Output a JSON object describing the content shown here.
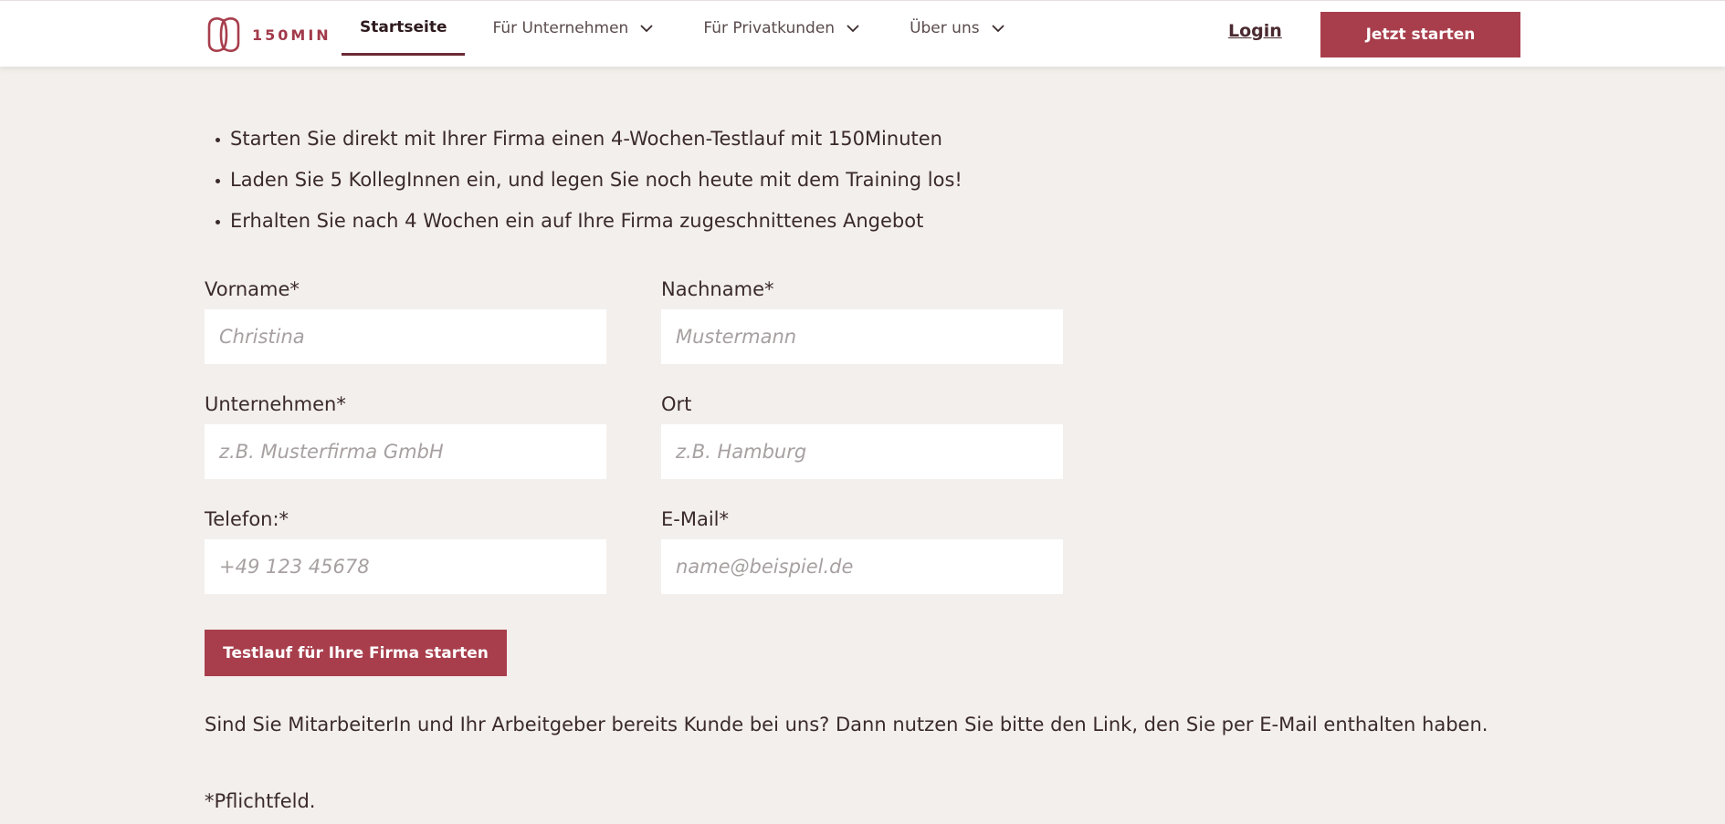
{
  "brand": {
    "logo_text": "150MIN",
    "accent": "#a83e4c",
    "icon": "logo-mark-icon"
  },
  "nav": {
    "items": [
      {
        "label": "Startseite"
      },
      {
        "label": "Für Unternehmen",
        "icon": "chevron-down-icon"
      },
      {
        "label": "Für Privatkunden",
        "icon": "chevron-down-icon"
      },
      {
        "label": "Über uns",
        "icon": "chevron-down-icon"
      }
    ],
    "login": "Login",
    "cta": "Jetzt starten"
  },
  "intro": {
    "bullets": [
      "Starten Sie direkt mit Ihrer Firma einen 4-Wochen-Testlauf mit 150Minuten",
      "Laden Sie 5 KollegInnen ein, und legen Sie noch heute mit dem Training los!",
      "Erhalten Sie nach 4 Wochen ein auf Ihre Firma zugeschnittenes Angebot"
    ]
  },
  "form": {
    "vorname": {
      "label": "Vorname*",
      "placeholder": "Christina",
      "value": ""
    },
    "nachname": {
      "label": "Nachname*",
      "placeholder": "Mustermann",
      "value": ""
    },
    "unternehmen": {
      "label": "Unternehmen*",
      "placeholder": "z.B. Musterfirma GmbH",
      "value": ""
    },
    "ort": {
      "label": "Ort",
      "placeholder": "z.B. Hamburg",
      "value": ""
    },
    "telefon": {
      "label": "Telefon:*",
      "placeholder": "+49 123 45678",
      "value": ""
    },
    "email": {
      "label": "E-Mail*",
      "placeholder": "name@beispiel.de",
      "value": ""
    },
    "submit": "Testlauf für Ihre Firma starten"
  },
  "note": "Sind Sie MitarbeiterIn und Ihr Arbeitgeber bereits Kunde bei uns? Dann nutzen Sie bitte den Link, den Sie per E-Mail enthalten haben.",
  "required_note": "*Pflichtfeld."
}
